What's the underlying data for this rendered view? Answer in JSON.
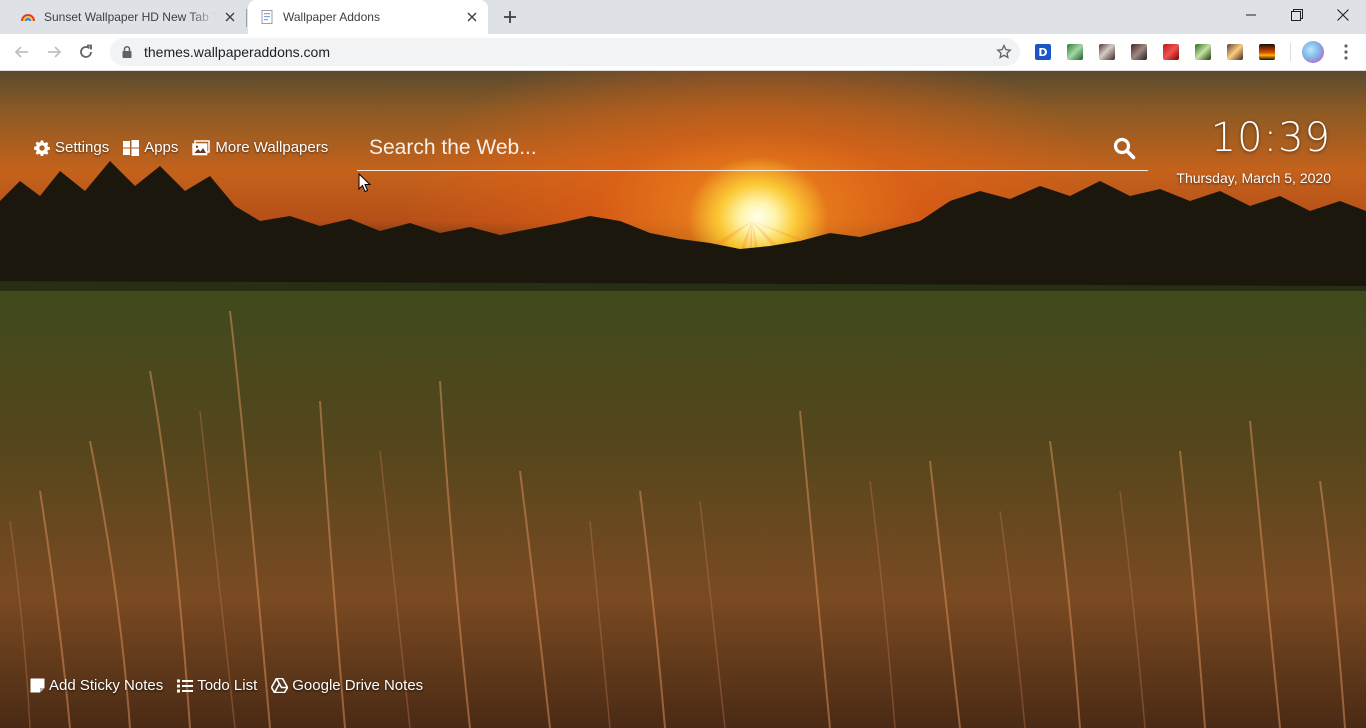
{
  "browser": {
    "tabs": [
      {
        "title": "Sunset Wallpaper HD New Tab Theme",
        "active": false,
        "favicon": "rainbow-icon"
      },
      {
        "title": "Wallpaper Addons",
        "active": true,
        "favicon": "document-icon"
      }
    ],
    "url": "themes.wallpaperaddons.com",
    "extensions": [
      "D"
    ]
  },
  "page": {
    "nav_links": {
      "settings": "Settings",
      "apps": "Apps",
      "more_wallpapers": "More Wallpapers"
    },
    "search": {
      "placeholder": "Search the Web..."
    },
    "clock": {
      "time": "10:39",
      "date": "Thursday, March 5, 2020"
    },
    "bottom_links": {
      "sticky_notes": "Add Sticky Notes",
      "todo": "Todo List",
      "drive_notes": "Google Drive Notes"
    }
  },
  "colors": {
    "toolbar_bg": "#ffffff",
    "tabstrip_bg": "#dee1e6",
    "omnibox_bg": "#f1f3f4"
  }
}
